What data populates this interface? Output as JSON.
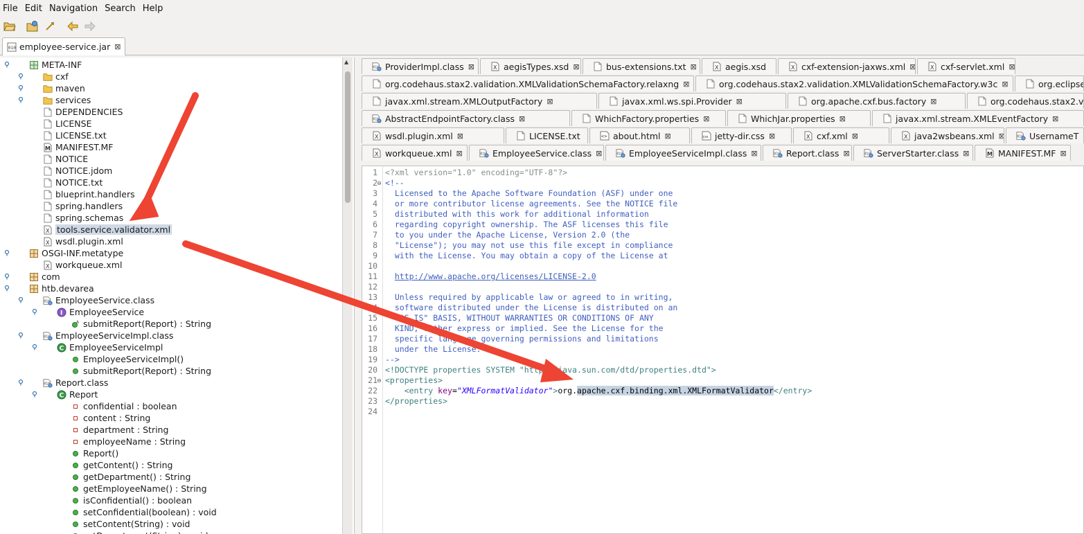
{
  "menu": [
    "File",
    "Edit",
    "Navigation",
    "Search",
    "Help"
  ],
  "toolbar": {
    "open_icon": "folder-open-icon",
    "open_all_icon": "open-multiple-icon",
    "jump_icon": "jump-icon",
    "back_icon": "back-arrow-icon",
    "forward_icon": "forward-arrow-icon"
  },
  "file_tab": {
    "label": "employee-service.jar",
    "close": "⊠"
  },
  "tree": [
    {
      "label": "META-INF",
      "type": "package",
      "depth": 0
    },
    {
      "label": "cxf",
      "type": "folder",
      "depth": 1
    },
    {
      "label": "maven",
      "type": "folder",
      "depth": 1
    },
    {
      "label": "services",
      "type": "folder",
      "depth": 1
    },
    {
      "label": "DEPENDENCIES",
      "type": "file",
      "depth": 1
    },
    {
      "label": "LICENSE",
      "type": "file",
      "depth": 1
    },
    {
      "label": "LICENSE.txt",
      "type": "file",
      "depth": 1
    },
    {
      "label": "MANIFEST.MF",
      "type": "manifest",
      "depth": 1
    },
    {
      "label": "NOTICE",
      "type": "file",
      "depth": 1
    },
    {
      "label": "NOTICE.jdom",
      "type": "file",
      "depth": 1
    },
    {
      "label": "NOTICE.txt",
      "type": "file",
      "depth": 1
    },
    {
      "label": "blueprint.handlers",
      "type": "file",
      "depth": 1
    },
    {
      "label": "spring.handlers",
      "type": "file",
      "depth": 1
    },
    {
      "label": "spring.schemas",
      "type": "file",
      "depth": 1
    },
    {
      "label": "tools.service.validator.xml",
      "type": "xml",
      "depth": 1,
      "selected": true
    },
    {
      "label": "wsdl.plugin.xml",
      "type": "xml",
      "depth": 1
    },
    {
      "label": "OSGI-INF.metatype",
      "type": "jpackage",
      "depth": 0
    },
    {
      "label": "workqueue.xml",
      "type": "xml",
      "depth": 1
    },
    {
      "label": "com",
      "type": "jpackage",
      "depth": 0
    },
    {
      "label": "htb.devarea",
      "type": "jpackage",
      "depth": 0
    },
    {
      "label": "EmployeeService.class",
      "type": "classfile",
      "depth": 1
    },
    {
      "label": "EmployeeService",
      "type": "interface",
      "depth": 2
    },
    {
      "label": "submitReport(Report) : String",
      "type": "abstract-method",
      "depth": 3
    },
    {
      "label": "EmployeeServiceImpl.class",
      "type": "classfile",
      "depth": 1
    },
    {
      "label": "EmployeeServiceImpl",
      "type": "class",
      "depth": 2
    },
    {
      "label": "EmployeeServiceImpl()",
      "type": "method",
      "depth": 3
    },
    {
      "label": "submitReport(Report) : String",
      "type": "method",
      "depth": 3
    },
    {
      "label": "Report.class",
      "type": "classfile",
      "depth": 1
    },
    {
      "label": "Report",
      "type": "class",
      "depth": 2
    },
    {
      "label": "confidential : boolean",
      "type": "field",
      "depth": 3
    },
    {
      "label": "content : String",
      "type": "field",
      "depth": 3
    },
    {
      "label": "department : String",
      "type": "field",
      "depth": 3
    },
    {
      "label": "employeeName : String",
      "type": "field",
      "depth": 3
    },
    {
      "label": "Report()",
      "type": "method",
      "depth": 3
    },
    {
      "label": "getContent() : String",
      "type": "method",
      "depth": 3
    },
    {
      "label": "getDepartment() : String",
      "type": "method",
      "depth": 3
    },
    {
      "label": "getEmployeeName() : String",
      "type": "method",
      "depth": 3
    },
    {
      "label": "isConfidential() : boolean",
      "type": "method",
      "depth": 3
    },
    {
      "label": "setConfidential(boolean) : void",
      "type": "method",
      "depth": 3
    },
    {
      "label": "setContent(String) : void",
      "type": "method",
      "depth": 3
    },
    {
      "label": "setDepartment(String) : void",
      "type": "method",
      "depth": 3
    }
  ],
  "editor_tab_rows": [
    [
      {
        "label": "ProviderImpl.class",
        "icon": "class"
      },
      {
        "label": "aegisTypes.xsd",
        "icon": "xml"
      },
      {
        "label": "bus-extensions.txt",
        "icon": "file"
      },
      {
        "label": "aegis.xsd",
        "icon": "xml"
      },
      {
        "label": "cxf-extension-jaxws.xml",
        "icon": "xml"
      },
      {
        "label": "cxf-servlet.xml",
        "icon": "xml"
      }
    ],
    [
      {
        "label": "org.codehaus.stax2.validation.XMLValidationSchemaFactory.relaxng",
        "icon": "file"
      },
      {
        "label": "org.codehaus.stax2.validation.XMLValidationSchemaFactory.w3c",
        "icon": "file"
      },
      {
        "label": "org.eclipse",
        "icon": "file"
      }
    ],
    [
      {
        "label": "javax.xml.stream.XMLOutputFactory",
        "icon": "file"
      },
      {
        "label": "javax.xml.ws.spi.Provider",
        "icon": "file"
      },
      {
        "label": "org.apache.cxf.bus.factory",
        "icon": "file"
      },
      {
        "label": "org.codehaus.stax2.v",
        "icon": "file"
      }
    ],
    [
      {
        "label": "AbstractEndpointFactory.class",
        "icon": "class"
      },
      {
        "label": "WhichFactory.properties",
        "icon": "file"
      },
      {
        "label": "WhichJar.properties",
        "icon": "file"
      },
      {
        "label": "javax.xml.stream.XMLEventFactory",
        "icon": "file"
      }
    ],
    [
      {
        "label": "wsdl.plugin.xml",
        "icon": "xml"
      },
      {
        "label": "LICENSE.txt",
        "icon": "file"
      },
      {
        "label": "about.html",
        "icon": "html"
      },
      {
        "label": "jetty-dir.css",
        "icon": "css"
      },
      {
        "label": "cxf.xml",
        "icon": "xml"
      },
      {
        "label": "java2wsbeans.xml",
        "icon": "xml"
      },
      {
        "label": "UsernameT",
        "icon": "class"
      }
    ],
    [
      {
        "label": "workqueue.xml",
        "icon": "xml"
      },
      {
        "label": "EmployeeService.class",
        "icon": "class"
      },
      {
        "label": "EmployeeServiceImpl.class",
        "icon": "class"
      },
      {
        "label": "Report.class",
        "icon": "class"
      },
      {
        "label": "ServerStarter.class",
        "icon": "class"
      },
      {
        "label": "MANIFEST.MF",
        "icon": "manifest"
      }
    ]
  ],
  "editor": {
    "lines": [
      "<?xml version=\"1.0\" encoding=\"UTF-8\"?>",
      "<!--",
      "  Licensed to the Apache Software Foundation (ASF) under one",
      "  or more contributor license agreements. See the NOTICE file",
      "  distributed with this work for additional information",
      "  regarding copyright ownership. The ASF licenses this file",
      "  to you under the Apache License, Version 2.0 (the",
      "  \"License\"); you may not use this file except in compliance",
      "  with the License. You may obtain a copy of the License at",
      "",
      "  http://www.apache.org/licenses/LICENSE-2.0",
      "",
      "  Unless required by applicable law or agreed to in writing,",
      "  software distributed under the License is distributed on an",
      "  \"AS IS\" BASIS, WITHOUT WARRANTIES OR CONDITIONS OF ANY",
      "  KIND, either express or implied. See the License for the",
      "  specific language governing permissions and limitations",
      "  under the License.",
      "-->",
      "<!DOCTYPE properties SYSTEM \"http://java.sun.com/dtd/properties.dtd\">",
      "<properties>",
      "    <entry key=\"XMLFormatValidator\">org.apache.cxf.binding.xml.XMLFormatValidator</entry>",
      "</properties>",
      ""
    ],
    "line_numbers": [
      "1",
      "2",
      "3",
      "4",
      "5",
      "6",
      "7",
      "8",
      "9",
      "10",
      "11",
      "12",
      "13",
      "14",
      "15",
      "16",
      "17",
      "18",
      "19",
      "20",
      "21",
      "22",
      "23",
      "24"
    ],
    "entry_key": "XMLFormatValidator",
    "entry_value_prefix": "org.",
    "entry_value_selected": "apache.cxf.binding.xml.XMLFormatValidator"
  },
  "colors": {
    "arrow": "#ee4433",
    "selection": "#c6d3e3",
    "comment": "#3f5fbf",
    "tag": "#3f7f7f"
  }
}
